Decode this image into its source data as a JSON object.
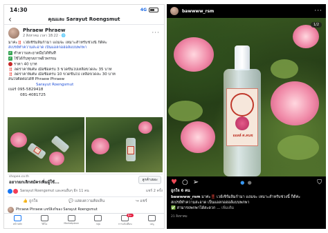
{
  "facebook": {
    "status_bar": {
      "time": "14:30",
      "signal": "4G"
    },
    "nav": {
      "back": "‹",
      "title": "คุณและ Sarayut Roengsmut"
    },
    "post": {
      "author": "Phraew Phraew",
      "date": "2 สิงหาคม เวลา 18:22 · 🌐",
      "more": "···",
      "lines": [
        "มาค่ะ‼️ เวย์เซิร์มลิมก้ามา แถมจะ เหมาะสำหรับช่วงนี้ ก็ดีค่ะ",
        "สเปรย์ทำความสะอาด เป็นแอลกอฮอล์แบบพกพา",
        "ทำความสะอาดมือได้ทันที",
        "ใช้ได้กับทุกสภาพผิวพรรณ",
        "ราคา 40 บาท",
        "‼️ ลดราคาพิเศษ เมื่อซื้อครบ 3 ขวดขึ้นไปเหลือขวดละ 35 บาท",
        "‼️ ลดราคาพิเศษ เมื่อซื้อครบ 10 ขวดขึ้นไป เหลือขวดละ 30 บาท",
        "สนใจติดต่อได้ที่ Phraew Phraew",
        "Sarayut Roengsmut",
        "เบอร์ 095-5829418",
        "081-4081725"
      ],
      "photo_caption": {
        "source": "shopee.co.th",
        "title": "อยากยกเลิกสมัครเพิ่มผู้ใช้...",
        "button": "ลูกค้าเยอะ"
      },
      "reactions": {
        "text": "Sarayut Roengsmut และคนอื่นๆ อีก 11 คน",
        "shares": "แชร์ 2 ครั้ง"
      },
      "actions": [
        "ถูกใจ",
        "แสดงความคิดเห็น",
        "แชร์"
      ],
      "next_post": "Phraew Phraew แชร์ลิงก์ของ Sarayut Roengsmut"
    },
    "tab_bar": [
      {
        "label": "หน้าหลัก",
        "icon": "home-icon",
        "badge": ""
      },
      {
        "label": "วิดีโอ",
        "icon": "video-icon",
        "badge": ""
      },
      {
        "label": "Marketplace",
        "icon": "marketplace-icon",
        "badge": ""
      },
      {
        "label": "กลุ่ม",
        "icon": "groups-icon",
        "badge": ""
      },
      {
        "label": "การแจ้งเตือน",
        "icon": "bell-icon",
        "badge": "9+"
      },
      {
        "label": "เมนู",
        "icon": "menu-icon",
        "badge": ""
      }
    ]
  },
  "instagram": {
    "username": "bawwww_rsm",
    "more": "···",
    "counter": "1/2",
    "product_label": "ออลล์ ศ.คนช",
    "likes": "ถูกใจ 6 คน",
    "caption": {
      "username": "bawwww_rsm",
      "text": "มาค่ะ‼️ เวย์เซิร์มลิมก้ามา แถมจะ เหมาะสำหรับช่วงนี้ ก็ดีค่ะ",
      "line2": "สเปรย์ทำความสะอาด เป็นแอลกอฮอล์แบบพกพา",
      "line3": "✅ สามารถพกพาได้สะดวก ...",
      "more": "เพิ่มเติม"
    },
    "time": "21 สิงหาคม",
    "colors": {
      "heart": "#ed4956",
      "dot_active": "#3897f0",
      "background": "#000000"
    }
  }
}
